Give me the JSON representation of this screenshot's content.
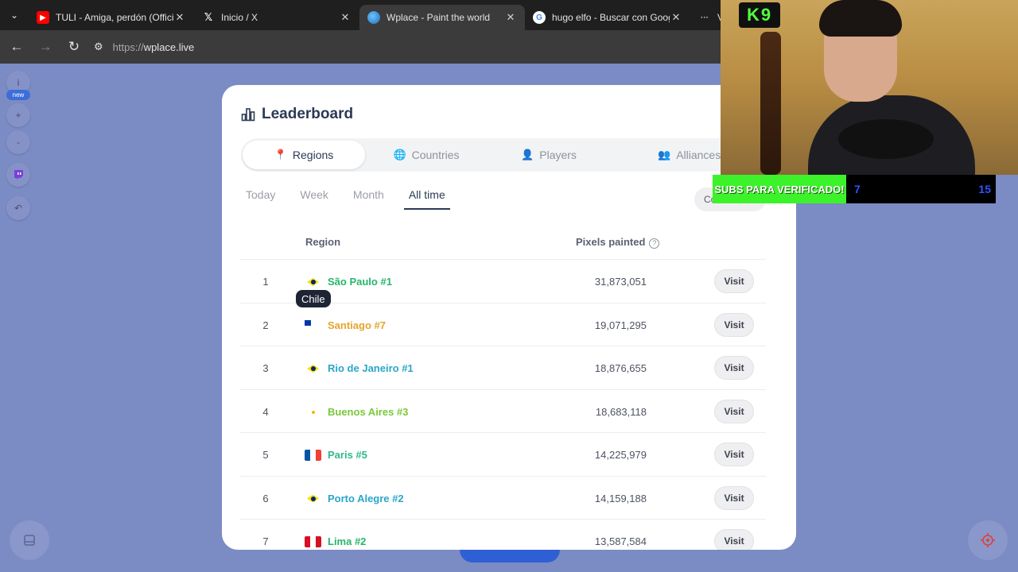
{
  "browser": {
    "tabs": [
      {
        "title": "TULI - Amiga, perdón (Offici",
        "favicon": "youtube-icon",
        "color": "#ff0000"
      },
      {
        "title": "Inicio / X",
        "favicon": "x-icon",
        "color": "#ffffff"
      },
      {
        "title": "Wplace - Paint the world",
        "favicon": "globe-icon",
        "color": "#4aa3df"
      },
      {
        "title": "hugo elfo - Buscar con Goog",
        "favicon": "google-icon",
        "color": "#ffffff"
      },
      {
        "title": "Va",
        "favicon": "dots-icon",
        "color": "#cccccc"
      }
    ],
    "url_protocol": "https://",
    "url_host": "wplace.live"
  },
  "toolbar": {
    "info_label": "i",
    "new_badge": "new",
    "zoom_in": "+",
    "zoom_out": "-",
    "undo": "↶"
  },
  "leaderboard": {
    "title": "Leaderboard",
    "tabs": [
      {
        "label": "Regions",
        "icon": "map-pin-icon",
        "active": true
      },
      {
        "label": "Countries",
        "icon": "globe-icon",
        "active": false
      },
      {
        "label": "Players",
        "icon": "user-icon",
        "active": false
      },
      {
        "label": "Alliances",
        "icon": "users-icon",
        "active": false
      }
    ],
    "periods": [
      "Today",
      "Week",
      "Month",
      "All time"
    ],
    "active_period": "All time",
    "country_button": "Co",
    "headers": {
      "region": "Region",
      "pixels": "Pixels painted"
    },
    "visit_label": "Visit",
    "tooltip": "Chile",
    "rows": [
      {
        "rank": "1",
        "flag": "br",
        "region": "São Paulo #1",
        "pixels": "31,873,051",
        "color": "#27b56a"
      },
      {
        "rank": "2",
        "flag": "cl",
        "region": "Santiago #7",
        "pixels": "19,071,295",
        "color": "#e3a62b"
      },
      {
        "rank": "3",
        "flag": "br",
        "region": "Rio de Janeiro #1",
        "pixels": "18,876,655",
        "color": "#2aa6c9"
      },
      {
        "rank": "4",
        "flag": "ar",
        "region": "Buenos Aires #3",
        "pixels": "18,683,118",
        "color": "#79c93a"
      },
      {
        "rank": "5",
        "flag": "fr",
        "region": "Paris #5",
        "pixels": "14,225,979",
        "color": "#2fb98c"
      },
      {
        "rank": "6",
        "flag": "br",
        "region": "Porto Alegre #2",
        "pixels": "14,159,188",
        "color": "#2aa6c9"
      },
      {
        "rank": "7",
        "flag": "pe",
        "region": "Lima #2",
        "pixels": "13,587,584",
        "color": "#27b56a"
      }
    ]
  },
  "overlay": {
    "logo": "K9",
    "subs_text": "SUBS PARA VERIFICADO!",
    "subs_count": "7",
    "subs_goal": "15"
  }
}
